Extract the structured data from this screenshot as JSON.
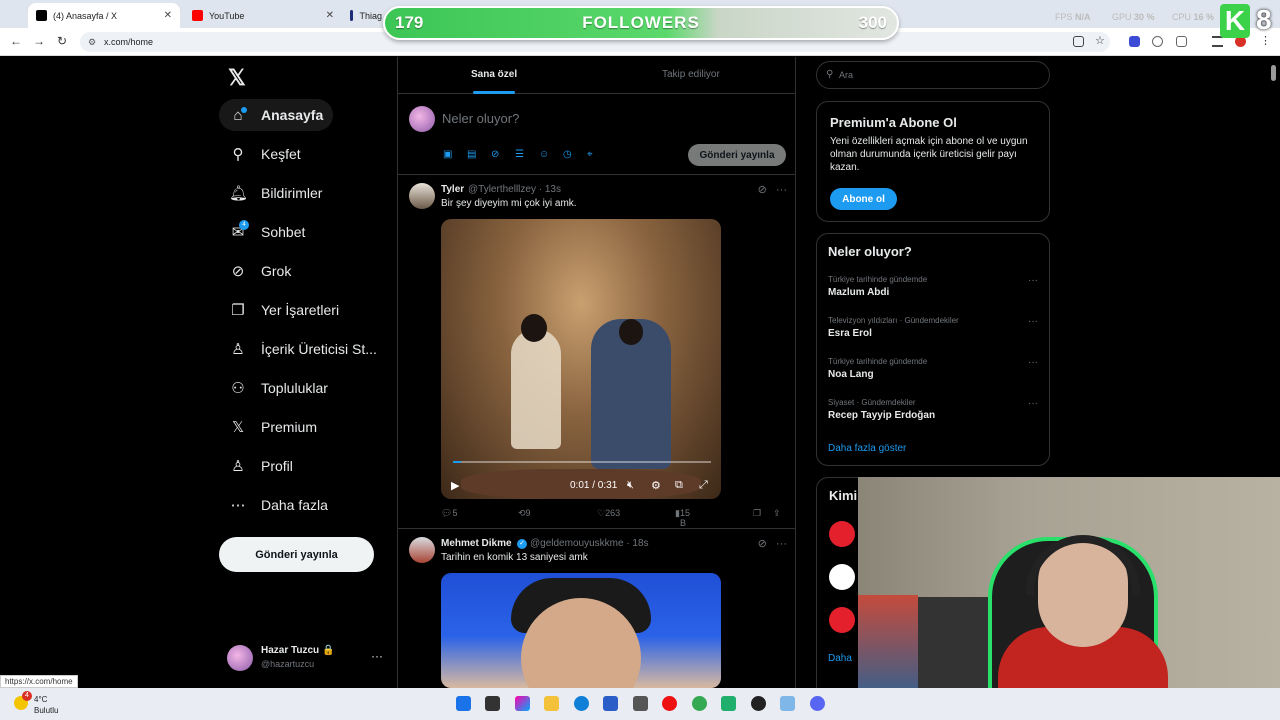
{
  "browser": {
    "tabs": [
      {
        "label": "(4) Anasayfa / X",
        "color": "#000000"
      },
      {
        "label": "YouTube",
        "color": "#ff0000"
      },
      {
        "label": "Thiag",
        "color": "#1c2b7a"
      }
    ],
    "url": "x.com/home",
    "status_url": "https://x.com/home"
  },
  "overlay": {
    "followers_current": "179",
    "followers_label": "FOLLOWERS",
    "followers_goal": "300",
    "followers_progress": 0.6,
    "fps_label": "FPS",
    "fps_value": "N/A",
    "gpu_label": "GPU",
    "gpu_value": "30 %",
    "cpu_label": "CPU",
    "cpu_value": "16 %",
    "k_mark": "K",
    "k_count": "8"
  },
  "sidebar": {
    "logo": "𝕏",
    "items": [
      {
        "label": "Anasayfa",
        "icon": "home-icon",
        "glyph": "⌂"
      },
      {
        "label": "Keşfet",
        "icon": "search-icon",
        "glyph": "⚲"
      },
      {
        "label": "Bildirimler",
        "icon": "bell-icon",
        "glyph": "🔔︎"
      },
      {
        "label": "Sohbet",
        "icon": "mail-icon",
        "glyph": "✉",
        "badge": "4"
      },
      {
        "label": "Grok",
        "icon": "grok-icon",
        "glyph": "⊘"
      },
      {
        "label": "Yer İşaretleri",
        "icon": "bookmark-icon",
        "glyph": "❐"
      },
      {
        "label": "İçerik Üreticisi St...",
        "icon": "creator-icon",
        "glyph": "♙"
      },
      {
        "label": "Topluluklar",
        "icon": "communities-icon",
        "glyph": "⚇"
      },
      {
        "label": "Premium",
        "icon": "x-premium-icon",
        "glyph": "𝕏"
      },
      {
        "label": "Profil",
        "icon": "profile-icon",
        "glyph": "♙"
      },
      {
        "label": "Daha fazla",
        "icon": "more-circle-icon",
        "glyph": "⋯"
      }
    ],
    "post_button": "Gönderi yayınla",
    "profile": {
      "name": "Hazar Tuzcu 🔒",
      "handle": "@hazartuzcu",
      "more": "···"
    }
  },
  "feed": {
    "tabs": [
      {
        "label": "Sana özel"
      },
      {
        "label": "Takip ediliyor"
      }
    ],
    "composer_placeholder": "Neler oluyor?",
    "composer_post": "Gönderi yayınla",
    "tweets": [
      {
        "name": "Tyler",
        "handle": "@Tylerthelllzey",
        "time": "· 13s",
        "text": "Bir şey diyeyim mi çok iyi amk.",
        "video_time": "0:01 / 0:31",
        "video_progress": 0.03,
        "replies": "5",
        "retweets": "9",
        "likes": "263",
        "views": "15 B"
      },
      {
        "name": "Mehmet Dikme",
        "handle": "@geldemouyuskkme",
        "time": "· 18s",
        "text": "Tarihin en komik 13 saniyesi amk"
      }
    ]
  },
  "right": {
    "search_placeholder": "Ara",
    "premium": {
      "title": "Premium'a Abone Ol",
      "text": "Yeni özellikleri açmak için abone ol ve uygun olman durumunda içerik üreticisi gelir payı kazan.",
      "button": "Abone ol"
    },
    "trends": {
      "title": "Neler oluyor?",
      "items": [
        {
          "context": "Türkiye tarihinde gündemde",
          "name": "Mazlum Abdi"
        },
        {
          "context": "Televizyon yıldızları · Gündemdekiler",
          "name": "Esra Erol"
        },
        {
          "context": "Türkiye tarihinde gündemde",
          "name": "Noa Lang"
        },
        {
          "context": "Siyaset · Gündemdekiler",
          "name": "Recep Tayyip Erdoğan"
        }
      ],
      "show_more": "Daha fazla göster"
    },
    "who_to_follow": {
      "title": "Kimi",
      "show_more": "Daha"
    }
  },
  "taskbar": {
    "weather_temp": "4°C",
    "weather_cond": "Bulutlu",
    "weather_badge": "4"
  }
}
